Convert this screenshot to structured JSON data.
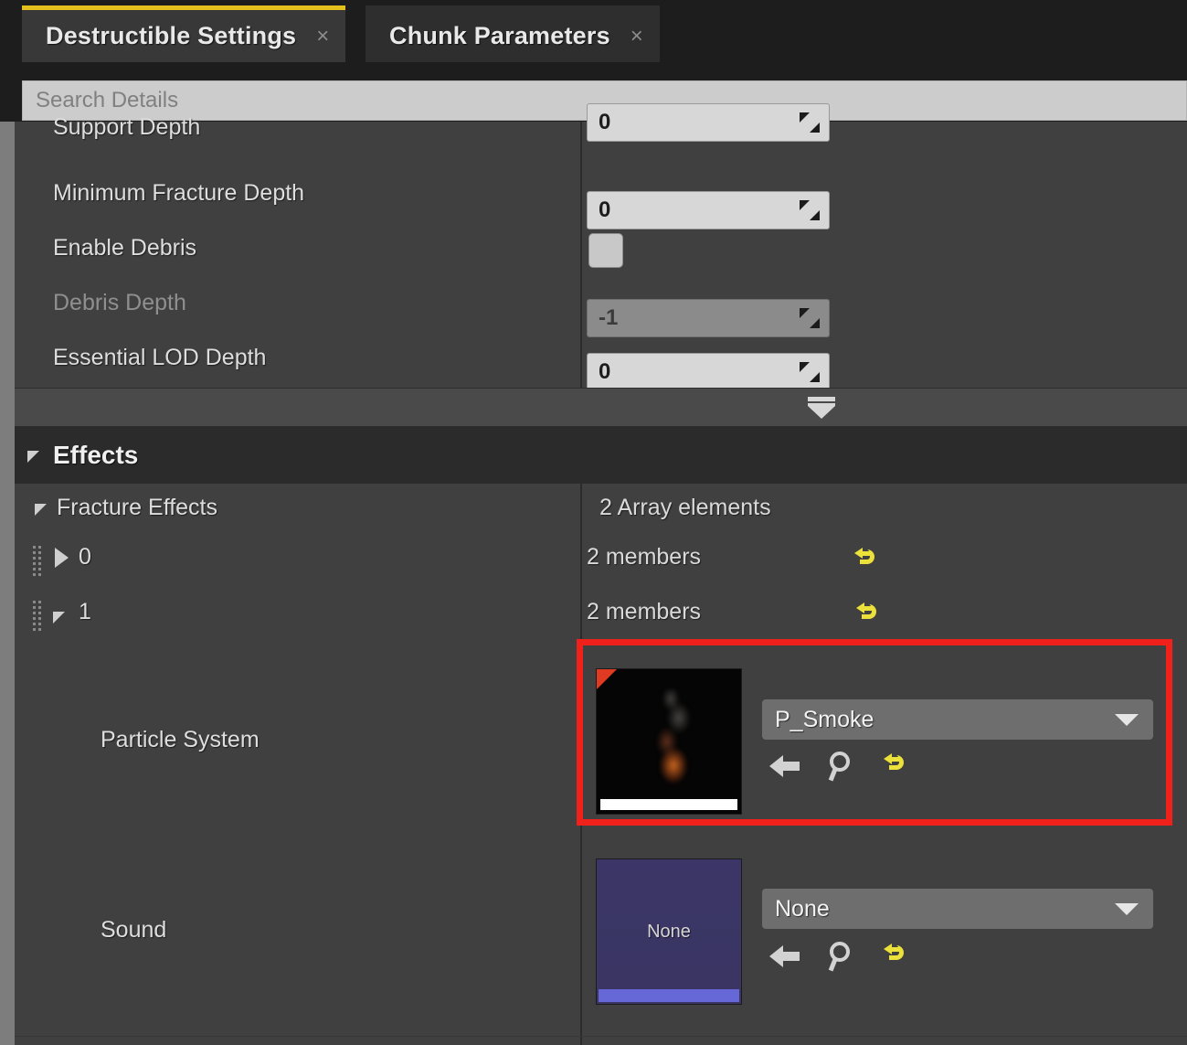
{
  "window": {
    "accent_yellow": "#e5c01c",
    "highlight_red": "#f0201a"
  },
  "tabs": [
    {
      "label": "Destructible Settings",
      "close": "×",
      "active": true
    },
    {
      "label": "Chunk Parameters",
      "close": "×",
      "active": false
    }
  ],
  "search": {
    "placeholder": "Search Details",
    "value": ""
  },
  "properties": [
    {
      "label": "Support Depth",
      "value": "0",
      "kind": "number",
      "enabled": true
    },
    {
      "label": "Minimum Fracture Depth",
      "value": "0",
      "kind": "number",
      "enabled": true
    },
    {
      "label": "Enable Debris",
      "value": "",
      "kind": "checkbox",
      "checked": false,
      "enabled": true
    },
    {
      "label": "Debris Depth",
      "value": "-1",
      "kind": "number",
      "enabled": false
    },
    {
      "label": "Essential LOD Depth",
      "value": "0",
      "kind": "number",
      "enabled": true
    }
  ],
  "category": {
    "title": "Effects",
    "expanded": true
  },
  "array": {
    "label": "Fracture Effects",
    "count_text": "2 Array elements",
    "elements": [
      {
        "index": "0",
        "members_text": "2 members",
        "expanded": false,
        "reset_icon": "reset-arrow-icon"
      },
      {
        "index": "1",
        "members_text": "2 members",
        "expanded": true,
        "reset_icon": "reset-arrow-icon"
      }
    ]
  },
  "asset_rows": [
    {
      "label": "Particle System",
      "selected": "P_Smoke",
      "thumbnail": "particle-thumbnail",
      "thumb_caption": "",
      "highlighted": true,
      "tools": {
        "back": "use-selected-asset-icon",
        "browse": "browse-to-asset-icon",
        "reset": "reset-arrow-icon"
      }
    },
    {
      "label": "Sound",
      "selected": "None",
      "thumbnail": "sound-thumbnail",
      "thumb_caption": "None",
      "highlighted": false,
      "tools": {
        "back": "use-selected-asset-icon",
        "browse": "browse-to-asset-icon",
        "reset": "reset-arrow-icon"
      }
    }
  ],
  "toolbar": {
    "collapse_all": "collapse-all-icon"
  }
}
